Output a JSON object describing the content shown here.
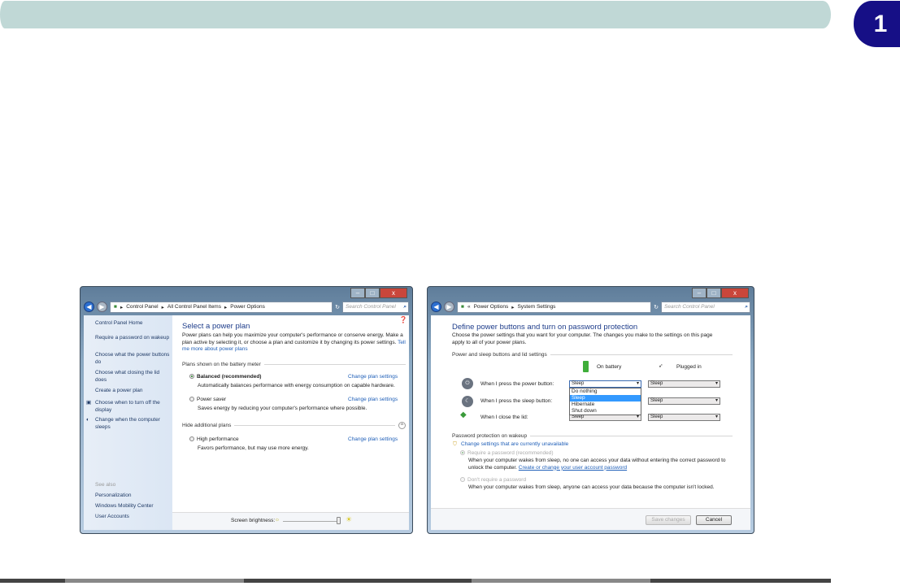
{
  "page": {
    "tab_number": "1",
    "colors": {
      "header": "#c0d8d6",
      "tab": "#160f86"
    }
  },
  "left": {
    "controls": {
      "min": "–",
      "max": "□",
      "close": "x"
    },
    "breadcrumb": [
      "Control Panel",
      "All Control Panel Items",
      "Power Options"
    ],
    "search_placeholder": "Search Control Panel",
    "sidebar": [
      "Control Panel Home",
      "Require a password on wakeup",
      "Choose what the power buttons do",
      "Choose what closing the lid does",
      "Create a power plan",
      "Choose when to turn off the display",
      "Change when the computer sleeps"
    ],
    "see_also": "See also",
    "see_also_links": [
      "Personalization",
      "Windows Mobility Center",
      "User Accounts"
    ],
    "title": "Select a power plan",
    "intro": "Power plans can help you maximize your computer's performance or conserve energy. Make a plan active by selecting it, or choose a plan and customize it by changing its power settings.",
    "intro_link": "Tell me more about power plans",
    "group1": "Plans shown on the battery meter",
    "group2": "Hide additional plans",
    "plans": [
      {
        "name": "Balanced (recommended)",
        "desc": "Automatically balances performance with energy consumption on capable hardware.",
        "link": "Change plan settings",
        "selected": true
      },
      {
        "name": "Power saver",
        "desc": "Saves energy by reducing your computer's performance where possible.",
        "link": "Change plan settings",
        "selected": false
      },
      {
        "name": "High performance",
        "desc": "Favors performance, but may use more energy.",
        "link": "Change plan settings",
        "selected": false
      }
    ],
    "brightness_label": "Screen brightness:",
    "brightness_level": 0.95
  },
  "right": {
    "controls": {
      "min": "–",
      "max": "□",
      "close": "x"
    },
    "breadcrumb": [
      "Power Options",
      "System Settings"
    ],
    "search_placeholder": "Search Control Panel",
    "title": "Define power buttons and turn on password protection",
    "intro": "Choose the power settings that you want for your computer. The changes you make to the settings on this page apply to all of your power plans.",
    "group1": "Power and sleep buttons and lid settings",
    "col_battery": "On battery",
    "col_plugged": "Plugged in",
    "rows": [
      {
        "label": "When I press the power button:",
        "battery": "Sleep",
        "plugged": "Sleep"
      },
      {
        "label": "When I press the sleep button:",
        "battery": "Sleep",
        "plugged": "Sleep"
      },
      {
        "label": "When I close the lid:",
        "battery": "Sleep",
        "plugged": "Sleep"
      }
    ],
    "dropdown_options": [
      "Do nothing",
      "Sleep",
      "Hibernate",
      "Shut down"
    ],
    "dropdown_highlighted": "Sleep",
    "group2": "Password protection on wakeup",
    "change_link": "Change settings that are currently unavailable",
    "opt1": "Require a password (recommended)",
    "opt1_desc": "When your computer wakes from sleep, no one can access your data without entering the correct password to unlock the computer.",
    "opt1_link": "Create or change your user account password",
    "opt2": "Don't require a password",
    "opt2_desc": "When your computer wakes from sleep, anyone can access your data because the computer isn't locked.",
    "save": "Save changes",
    "cancel": "Cancel"
  }
}
